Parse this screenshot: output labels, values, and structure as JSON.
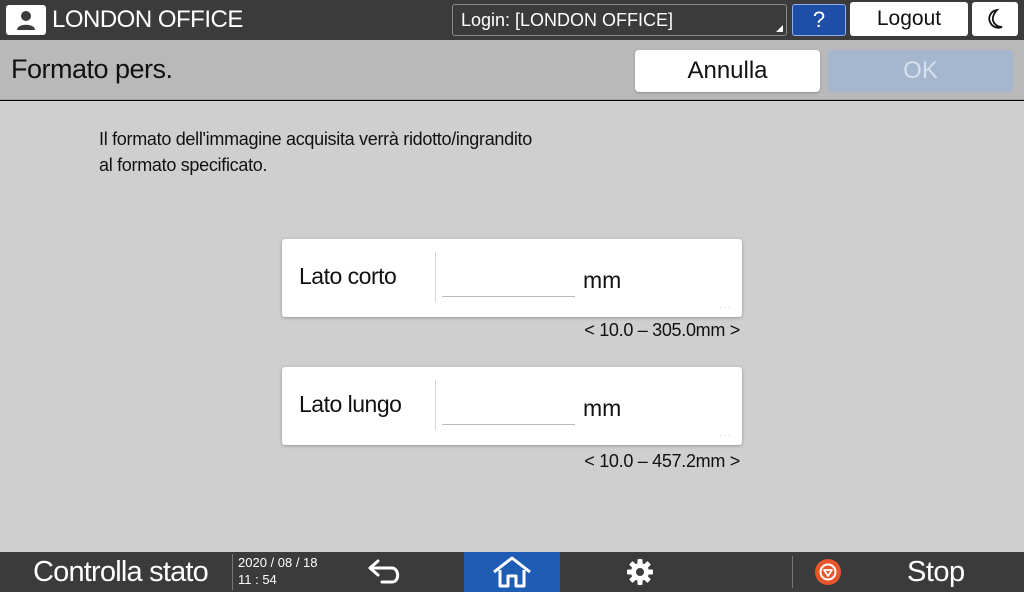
{
  "header": {
    "user_name": "LONDON OFFICE",
    "login_text": "Login: [LONDON OFFICE]",
    "help_label": "?",
    "logout_label": "Logout"
  },
  "titlebar": {
    "title": "Formato pers.",
    "cancel_label": "Annulla",
    "ok_label": "OK"
  },
  "main": {
    "description_lines": [
      "Il formato dell'immagine acquisita verrà ridotto/ingrandito",
      "al formato specificato."
    ],
    "fields": [
      {
        "label": "Lato corto",
        "value": "",
        "unit": "mm",
        "range": "< 10.0 – 305.0mm >"
      },
      {
        "label": "Lato lungo",
        "value": "",
        "unit": "mm",
        "range": "< 10.0 – 457.2mm >"
      }
    ]
  },
  "footer": {
    "status_label": "Controlla stato",
    "date": "2020 / 08 / 18",
    "time": "11 : 54",
    "stop_label": "Stop"
  },
  "colors": {
    "topbar_bg": "#3b3b3b",
    "title_bg": "#b9b9b9",
    "main_bg": "#cfcfcf",
    "accent_blue": "#1f5db5",
    "ok_disabled": "#a5b7cf",
    "stop_red": "#e8552b"
  },
  "icons": {
    "user": "user-icon",
    "moon": "moon-icon",
    "back": "back-arrow-icon",
    "home": "home-icon",
    "settings": "gear-icon",
    "stop": "stop-icon"
  }
}
